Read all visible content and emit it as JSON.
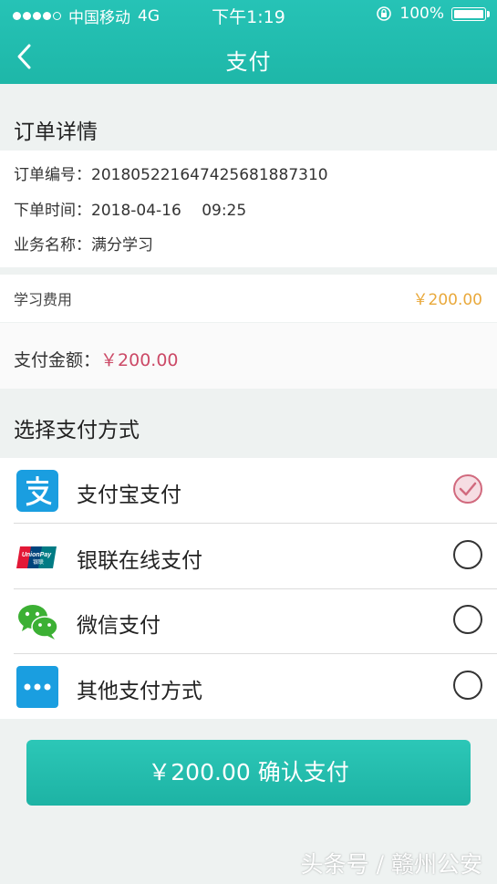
{
  "status_bar": {
    "carrier": "中国移动",
    "network": "4G",
    "time": "下午1:19",
    "battery_text": "100%"
  },
  "nav": {
    "title": "支付",
    "back_icon": "chevron-left-icon"
  },
  "order": {
    "section_title": "订单详情",
    "number_label": "订单编号：",
    "number_value": "201805221647425681887310",
    "time_label": "下单时间：",
    "time_value": "2018-04-16　 09:25",
    "service_label": "业务名称：",
    "service_value": "满分学习"
  },
  "fee": {
    "label": "学习费用",
    "value": "￥200.00"
  },
  "amount": {
    "label": "支付金额：",
    "value": "￥200.00"
  },
  "payment": {
    "section_title": "选择支付方式",
    "options": [
      {
        "label": "支付宝支付",
        "icon": "alipay-icon",
        "selected": true
      },
      {
        "label": "银联在线支付",
        "icon": "unionpay-icon",
        "selected": false
      },
      {
        "label": "微信支付",
        "icon": "wechat-icon",
        "selected": false
      },
      {
        "label": "其他支付方式",
        "icon": "more-icon",
        "selected": false
      }
    ]
  },
  "confirm_button": {
    "label": "￥200.00 确认支付"
  },
  "watermark": "头条号 / 赣州公安",
  "colors": {
    "accent": "#1eb7a8",
    "fee_price": "#e9a93c",
    "amount_price": "#cc4a67",
    "selected_radio": "#d16a7e"
  }
}
